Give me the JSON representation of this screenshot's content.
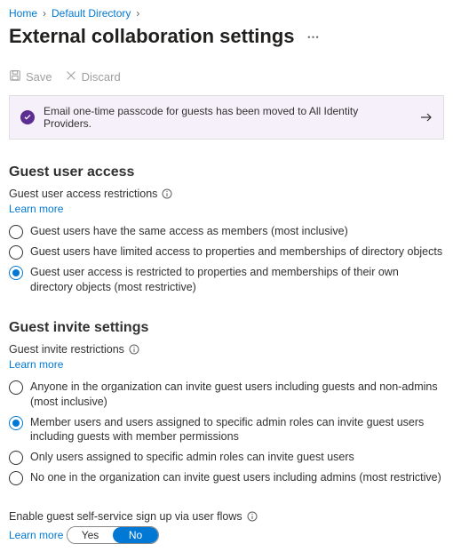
{
  "breadcrumb": {
    "home": "Home",
    "dir": "Default Directory"
  },
  "page_title": "External collaboration settings",
  "toolbar": {
    "save": "Save",
    "discard": "Discard"
  },
  "banner": {
    "text": "Email one-time passcode for guests has been moved to All Identity Providers."
  },
  "access": {
    "heading": "Guest user access",
    "subhead": "Guest user access restrictions",
    "learn": "Learn more",
    "options": [
      "Guest users have the same access as members (most inclusive)",
      "Guest users have limited access to properties and memberships of directory objects",
      "Guest user access is restricted to properties and memberships of their own directory objects (most restrictive)"
    ],
    "selected": 2
  },
  "invite": {
    "heading": "Guest invite settings",
    "subhead": "Guest invite restrictions",
    "learn": "Learn more",
    "options": [
      "Anyone in the organization can invite guest users including guests and non-admins (most inclusive)",
      "Member users and users assigned to specific admin roles can invite guest users including guests with member permissions",
      "Only users assigned to specific admin roles can invite guest users",
      "No one in the organization can invite guest users including admins (most restrictive)"
    ],
    "selected": 1
  },
  "selfservice": {
    "label": "Enable guest self-service sign up via user flows",
    "learn": "Learn more",
    "yes": "Yes",
    "no": "No",
    "value": "no"
  }
}
